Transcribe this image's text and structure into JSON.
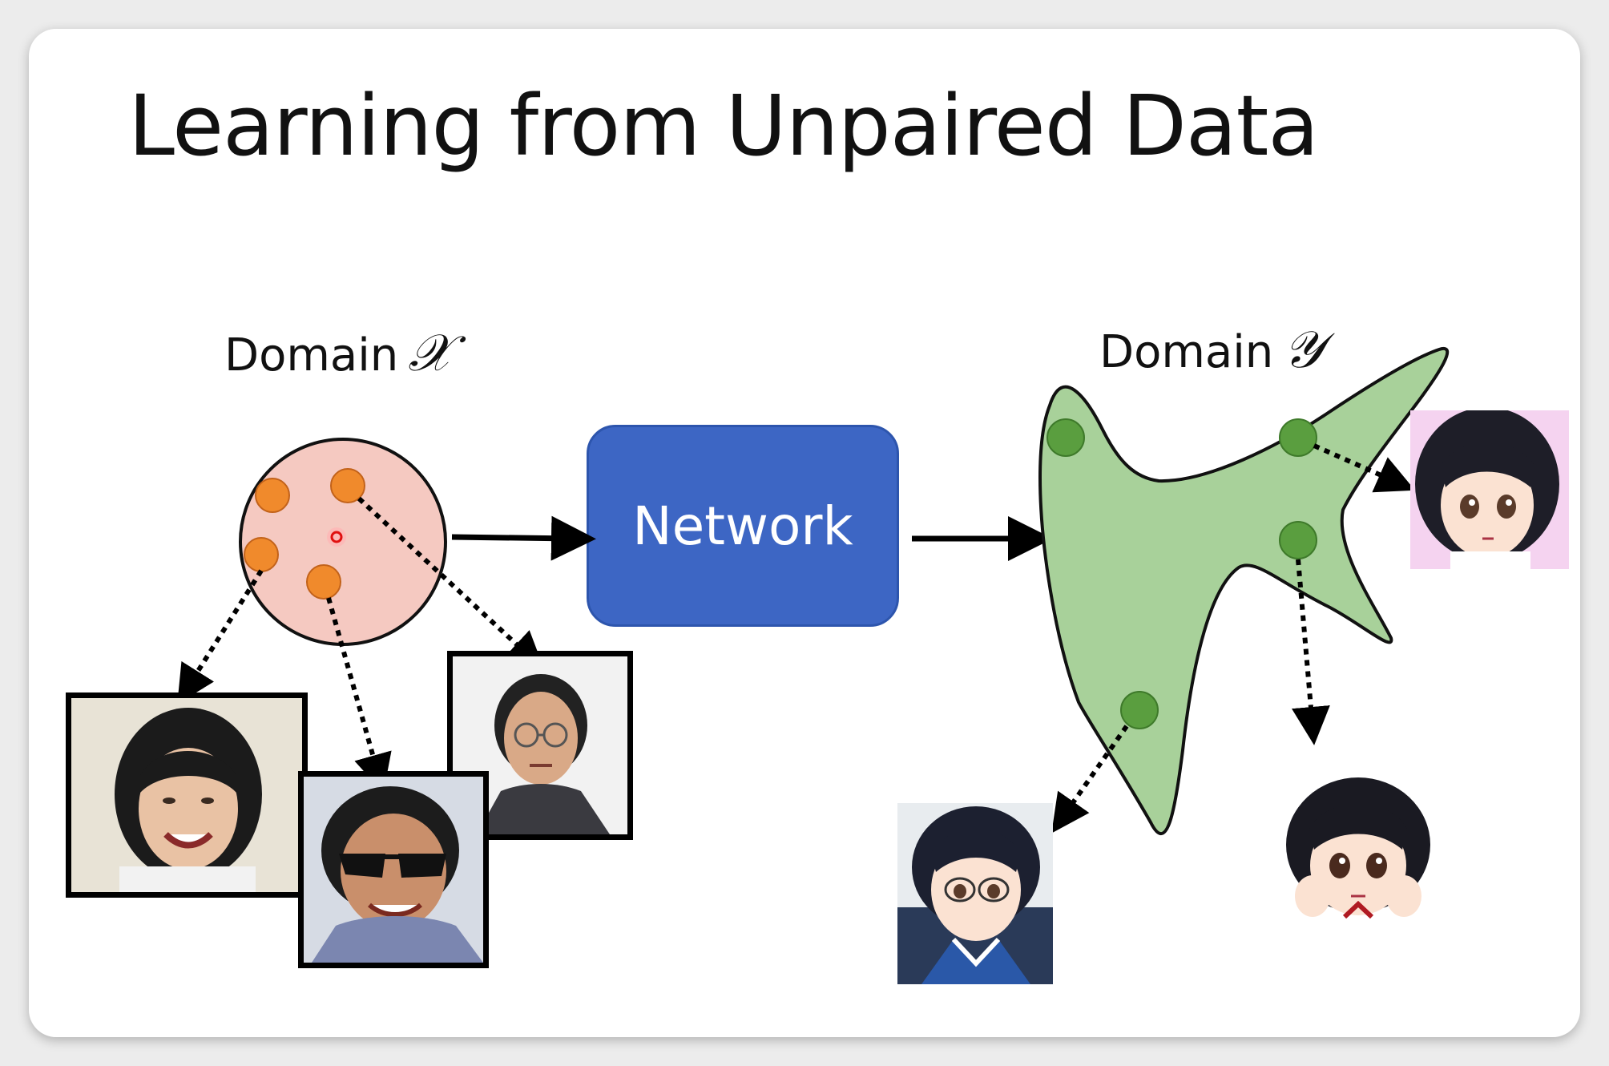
{
  "slide": {
    "title": "Learning from Unpaired Data",
    "domain_x_label": "Domain",
    "domain_x_symbol": "𝒳",
    "domain_y_label": "Domain",
    "domain_y_symbol": "𝒴",
    "network_label": "Network"
  },
  "colors": {
    "network_fill": "#3d66c4",
    "domain_x_fill": "#f5c9c1",
    "domain_x_points": "#f08a2c",
    "domain_y_fill": "#a8d19a",
    "domain_y_points": "#5a9e3f"
  },
  "images": {
    "real_faces": [
      "smiling-woman-photo",
      "man-with-sunglasses-photo",
      "man-with-glasses-photo"
    ],
    "anime_faces": [
      "anime-girl-photo-1",
      "anime-girl-photo-2",
      "anime-boy-with-glasses-photo"
    ]
  }
}
